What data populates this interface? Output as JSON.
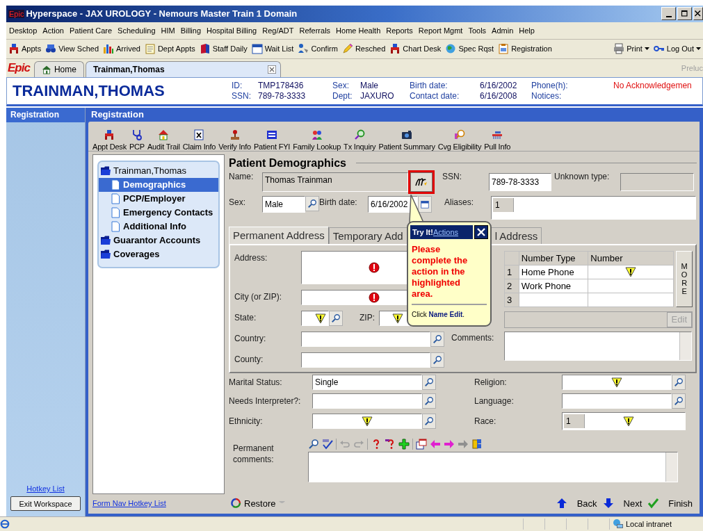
{
  "window": {
    "logo": "Epic",
    "title": "Hyperspace - JAX UROLOGY - Nemours Master Train 1 Domain"
  },
  "menu": [
    "Desktop",
    "Action",
    "Patient Care",
    "Scheduling",
    "HIM",
    "Billing",
    "Hospital Billing",
    "Reg/ADT",
    "Referrals",
    "Home Health",
    "Reports",
    "Report Mgmt",
    "Tools",
    "Admin",
    "Help"
  ],
  "toolbar": {
    "items": [
      "Appts",
      "View Sched",
      "Arrived",
      "Dept Appts",
      "Staff Daily",
      "Wait List",
      "Confirm",
      "Resched",
      "Chart Desk",
      "Spec Rqst",
      "Registration"
    ],
    "right": [
      {
        "label": "Print",
        "dropdown": true
      },
      {
        "label": "Log Out",
        "dropdown": true
      }
    ]
  },
  "tabs": {
    "logo": "Epic",
    "items": [
      {
        "label": "Home",
        "selected": false,
        "closable": false
      },
      {
        "label": "Trainman,Thomas",
        "selected": true,
        "closable": true
      }
    ],
    "right_text": "Preluc"
  },
  "patient": {
    "name": "TRAINMAN,THOMAS",
    "info": [
      [
        "ID:",
        "TMP178436",
        "Sex:",
        "Male",
        "Birth date:",
        "6/16/2002",
        "Phone(h):"
      ],
      [
        "SSN:",
        "789-78-3333",
        "Dept:",
        "JAXURO",
        "Contact date:",
        "6/16/2008",
        "Notices:"
      ]
    ],
    "alert": "No Acknowledgemen"
  },
  "sidebar": {
    "title": "Registration",
    "link": "Hotkey List",
    "button": "Exit Workspace"
  },
  "activity": {
    "title": "Registration",
    "buttons": [
      "Appt Desk",
      "PCP",
      "Audit Trail",
      "Claim Info",
      "Verify Info",
      "Patient FYI",
      "Family Lookup",
      "Tx Inquiry",
      "Patient Summary",
      "Cvg Eligibility",
      "Pull Info"
    ]
  },
  "tree": [
    {
      "label": "Trainman,Thomas",
      "kind": "patient",
      "selected": false,
      "children": [
        {
          "label": "Demographics",
          "kind": "page",
          "selected": true
        },
        {
          "label": "PCP/Employer",
          "kind": "page",
          "selected": false
        },
        {
          "label": "Emergency Contacts",
          "kind": "page",
          "selected": false
        },
        {
          "label": "Additional Info",
          "kind": "page",
          "selected": false
        }
      ]
    },
    {
      "label": "Guarantor Accounts",
      "kind": "folder",
      "selected": false
    },
    {
      "label": "Coverages",
      "kind": "folder",
      "selected": false
    }
  ],
  "form": {
    "title": "Patient Demographics",
    "name": {
      "label": "Name:",
      "value": "Thomas Trainman",
      "highlighted": true
    },
    "ssn": {
      "label": "SSN:",
      "value": "789-78-3333"
    },
    "unknown_type": {
      "label": "Unknown type:"
    },
    "sex": {
      "label": "Sex:",
      "value": "Male"
    },
    "birth_date": {
      "label": "Birth date:",
      "value": "6/16/2002"
    },
    "aliases": {
      "label": "Aliases:",
      "row": "1"
    },
    "address_tabs": [
      {
        "label": "Permanent Address",
        "selected": true
      },
      {
        "label": "Temporary Add",
        "selected": false
      },
      {
        "label": "l Address",
        "selected": false
      }
    ],
    "address_fields": [
      {
        "label": "Address:",
        "kind": "textarea",
        "error": true,
        "warning": false
      },
      {
        "label": "City (or ZIP):",
        "kind": "text",
        "error": true,
        "warning": false
      },
      {
        "label": "State:",
        "kind": "state",
        "error": false,
        "warning": true
      },
      {
        "label": "Country:",
        "kind": "lookup",
        "error": false,
        "warning": false
      },
      {
        "label": "County:",
        "kind": "lookup",
        "error": false,
        "warning": false
      }
    ],
    "zip": {
      "label": "ZIP:",
      "warning": true
    },
    "phones": {
      "columns": [
        "Number Type",
        "Number"
      ],
      "rows": [
        {
          "number": "1",
          "type": "Home Phone",
          "warning": true
        },
        {
          "number": "2",
          "type": "Work Phone",
          "warning": false
        },
        {
          "number": "3",
          "warning": false
        }
      ],
      "more": "MORE"
    },
    "edit_button": {
      "label": "Edit",
      "disabled": true
    },
    "comments": {
      "label": "Comments:"
    },
    "left_fields": [
      {
        "label": "Marital Status:",
        "value": "Single",
        "kind": "lookup",
        "warning": false
      },
      {
        "label": "Needs Interpreter?:",
        "kind": "lookup",
        "warning": false
      },
      {
        "label": "Ethnicity:",
        "kind": "lookup",
        "warning": true
      }
    ],
    "right_fields": [
      {
        "label": "Religion:",
        "kind": "lookup",
        "warning": true
      },
      {
        "label": "Language:",
        "kind": "lookup",
        "warning": false
      },
      {
        "label": "Race:",
        "kind": "list",
        "row": "1",
        "warning": true
      }
    ],
    "permanent_comments": {
      "label": "Permanent comments:"
    }
  },
  "tooltip": {
    "title": "Try It!",
    "link": "Actions",
    "message": "Please complete the action in the highlighted area.",
    "instruction": "Click **Name Edit**."
  },
  "footer": {
    "link": "Form Nav Hotkey List",
    "restore": "Restore",
    "back": "Back",
    "next": "Next",
    "finish": "Finish"
  },
  "status_bar": {
    "zone": "Local intranet"
  }
}
